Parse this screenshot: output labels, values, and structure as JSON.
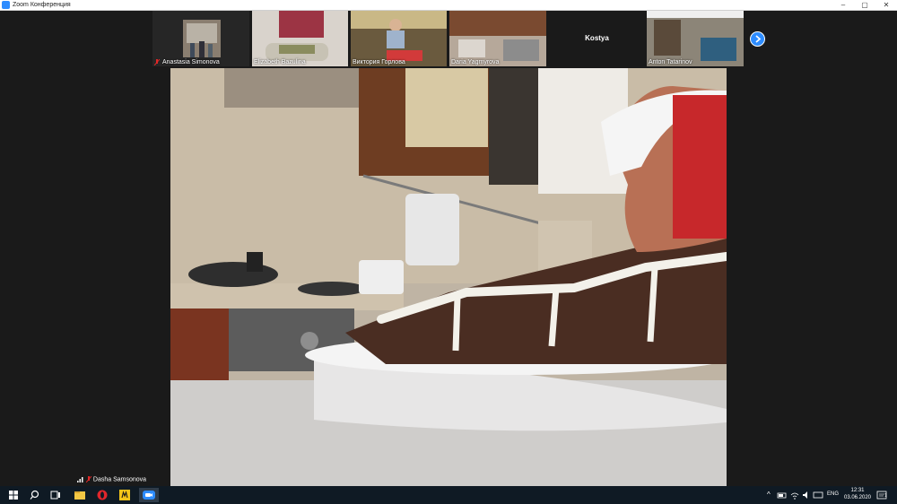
{
  "window": {
    "title": "Zoom Конференция",
    "buttons": [
      "–",
      "▢",
      "✕"
    ]
  },
  "participants": [
    {
      "name": "Anastasia Simonova",
      "muted": true
    },
    {
      "name": "Elizabeth Bazulina",
      "muted": false
    },
    {
      "name": "Виктория Горлова",
      "muted": false
    },
    {
      "name": "Daria Yagmyrova",
      "muted": false
    },
    {
      "name": "Kostya",
      "muted": false,
      "video_off": true
    },
    {
      "name": "Anton Tatarinov",
      "muted": false
    }
  ],
  "active_speaker": {
    "name": "Dasha Samsonova",
    "muted": true
  },
  "taskbar": {
    "apps": [
      "start-icon",
      "search-icon",
      "task-view-icon",
      "file-explorer-icon",
      "opera-icon",
      "miro-icon",
      "zoom-icon"
    ],
    "tray": {
      "language": "ENG",
      "time": "12:31",
      "date": "03.06.2020",
      "notification_count": "1"
    }
  },
  "colors": {
    "zoom_blue": "#2d8cff",
    "mute_red": "#e02828"
  }
}
